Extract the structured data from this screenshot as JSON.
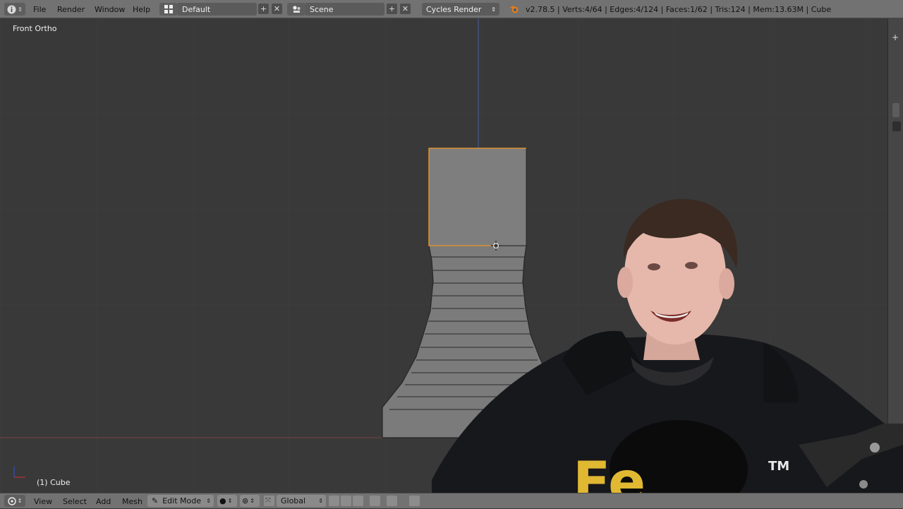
{
  "topbar": {
    "menus": [
      "File",
      "Render",
      "Window",
      "Help"
    ],
    "screen_layout": "Default",
    "scene": "Scene",
    "render_engine": "Cycles Render",
    "stats": "v2.78.5 | Verts:4/64 | Edges:4/124 | Faces:1/62 | Tris:124 | Mem:13.63M | Cube"
  },
  "viewport": {
    "view_label": "Front Ortho",
    "object_label": "(1) Cube"
  },
  "bottombar": {
    "menus": [
      "View",
      "Select",
      "Add",
      "Mesh"
    ],
    "mode": "Edit Mode",
    "orientation": "Global"
  },
  "webcam": {
    "shirt_text": "Fe",
    "trademark": "TM"
  },
  "colors": {
    "header": "#727272",
    "viewport_bg": "#393939",
    "mesh_face": "#7a7a7a",
    "selection": "#f39a2a"
  },
  "icons": [
    "info-icon",
    "screen-layout-icon",
    "scene-icon",
    "blender-logo-icon",
    "view3d-editor-icon",
    "edit-mode-icon",
    "viewport-shading-icon",
    "pivot-icon",
    "manipulator-icon",
    "layer-icon",
    "snap-icon",
    "proportional-icon"
  ]
}
